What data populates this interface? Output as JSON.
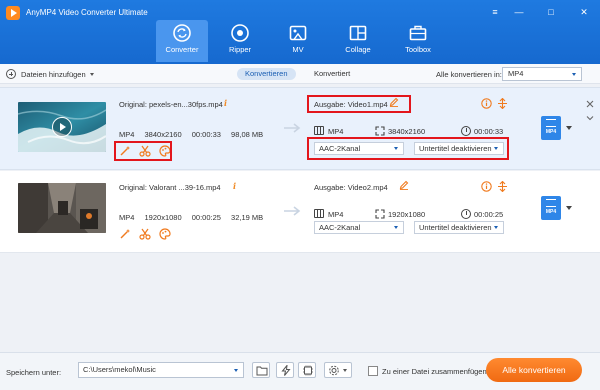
{
  "window": {
    "title": "AnyMP4 Video Converter Ultimate",
    "controls": {
      "menu": "≡",
      "minimize": "—",
      "maximize": "□",
      "close": "✕"
    }
  },
  "nav": {
    "tabs": [
      {
        "label": "Converter",
        "icon": "converter-icon",
        "active": true
      },
      {
        "label": "Ripper",
        "icon": "disc-icon",
        "active": false
      },
      {
        "label": "MV",
        "icon": "mv-icon",
        "active": false
      },
      {
        "label": "Collage",
        "icon": "collage-icon",
        "active": false
      },
      {
        "label": "Toolbox",
        "icon": "toolbox-icon",
        "active": false
      }
    ]
  },
  "toolbar": {
    "add_files_label": "Dateien hinzufügen",
    "tab_converting": "Konvertieren",
    "tab_converted": "Konvertiert",
    "convert_all_label": "Alle konvertieren in:",
    "convert_all_format": "MP4"
  },
  "files": [
    {
      "original_label": "Original: pexels-en...30fps.mp4",
      "src_format": "MP4",
      "src_resolution": "3840x2160",
      "src_duration": "00:00:33",
      "src_size": "98,08 MB",
      "output_label": "Ausgabe: Video1.mp4",
      "out_format": "MP4",
      "out_resolution": "3840x2160",
      "out_duration": "00:00:33",
      "audio_track": "AAC-2Kanal",
      "subtitle": "Untertitel deaktivieren",
      "badge_text": "MP4"
    },
    {
      "original_label": "Original: Valorant ...39-16.mp4",
      "src_format": "MP4",
      "src_resolution": "1920x1080",
      "src_duration": "00:00:25",
      "src_size": "32,19 MB",
      "output_label": "Ausgabe: Video2.mp4",
      "out_format": "MP4",
      "out_resolution": "1920x1080",
      "out_duration": "00:00:25",
      "audio_track": "AAC-2Kanal",
      "subtitle": "Untertitel deaktivieren",
      "badge_text": "MP4"
    }
  ],
  "footer": {
    "save_label": "Speichern unter:",
    "save_path": "C:\\Users\\mekol\\Music",
    "merge_label": "Zu einer Datei zusammenfügen",
    "convert_button": "Alle konvertieren"
  },
  "colors": {
    "header_blue": "#1f7ae0",
    "accent_orange": "#f07a1e",
    "highlight_red": "#e3161c"
  }
}
